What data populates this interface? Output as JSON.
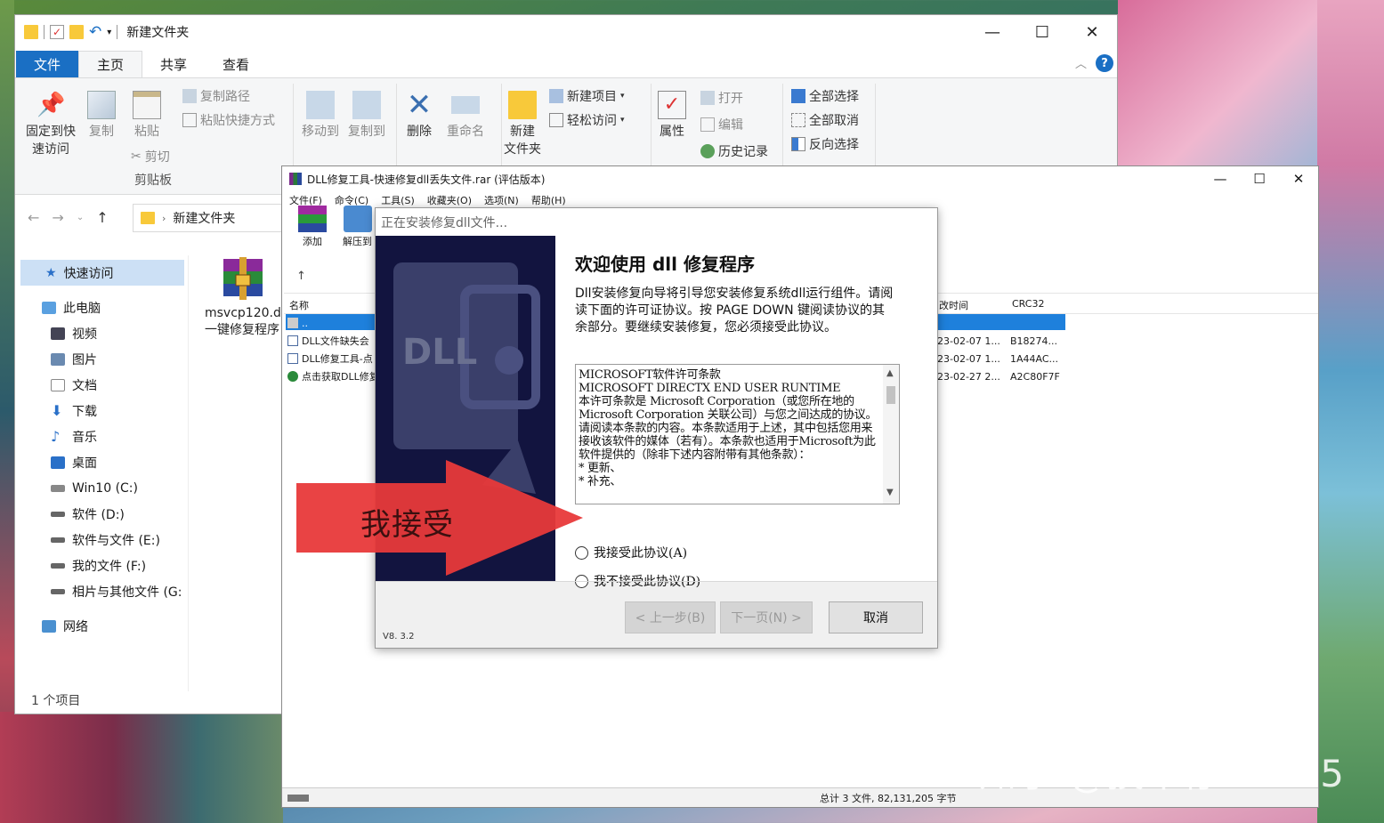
{
  "explorer": {
    "title": "新建文件夹",
    "tabs": [
      "文件",
      "主页",
      "共享",
      "查看"
    ],
    "ribbon": {
      "pin": [
        "固定到快",
        "速访问"
      ],
      "copy": "复制",
      "paste": "粘贴",
      "copy_path": "复制路径",
      "paste_shortcut": "粘贴快捷方式",
      "cut": "剪切",
      "clipboard_group": "剪贴板",
      "move_to": "移动到",
      "copy_to": "复制到",
      "delete": "删除",
      "rename": "重命名",
      "new_folder": [
        "新建",
        "文件夹"
      ],
      "new_item": "新建项目",
      "easy_access": "轻松访问",
      "properties": "属性",
      "open": "打开",
      "edit": "编辑",
      "history": "历史记录",
      "select_all": "全部选择",
      "select_none": "全部取消",
      "invert_select": "反向选择"
    },
    "address": {
      "path": "新建文件夹"
    },
    "nav": [
      {
        "label": "快速访问",
        "icon": "star-icon"
      },
      {
        "label": "此电脑",
        "icon": "computer-icon"
      },
      {
        "label": "视频",
        "icon": "video-icon"
      },
      {
        "label": "图片",
        "icon": "picture-icon"
      },
      {
        "label": "文档",
        "icon": "document-icon"
      },
      {
        "label": "下载",
        "icon": "download-icon"
      },
      {
        "label": "音乐",
        "icon": "music-icon"
      },
      {
        "label": "桌面",
        "icon": "desktop-icon"
      },
      {
        "label": "Win10 (C:)",
        "icon": "drive-icon"
      },
      {
        "label": "软件 (D:)",
        "icon": "drive-icon"
      },
      {
        "label": "软件与文件 (E:)",
        "icon": "drive-icon"
      },
      {
        "label": "我的文件 (F:)",
        "icon": "drive-icon"
      },
      {
        "label": "相片与其他文件 (G:",
        "icon": "drive-icon"
      },
      {
        "label": "网络",
        "icon": "network-icon"
      }
    ],
    "file": {
      "name_line1": "msvcp120.d",
      "name_line2": "一键修复程序"
    },
    "status": "1 个项目"
  },
  "rar": {
    "title": "DLL修复工具-快速修复dll丢失文件.rar (评估版本)",
    "menu": [
      "文件(F)",
      "命令(C)",
      "工具(S)",
      "收藏夹(O)",
      "选项(N)",
      "帮助(H)"
    ],
    "toolbar": [
      "添加",
      "解压到"
    ],
    "columns": {
      "name": "名称",
      "modified": "改时间",
      "crc": "CRC32"
    },
    "rows": [
      {
        "name": "..",
        "modified": "",
        "crc": ""
      },
      {
        "name": "DLL文件缺失会",
        "modified": "23-02-07 1...",
        "crc": "B18274..."
      },
      {
        "name": "DLL修复工具-点",
        "modified": "23-02-07 1...",
        "crc": "1A44AC..."
      },
      {
        "name": "点击获取DLL修复",
        "modified": "23-02-27 2...",
        "crc": "A2C80F7F"
      }
    ],
    "status": "总计 3 文件, 82,131,205 字节"
  },
  "dialog": {
    "title": "正在安装修复dll文件...",
    "side_logo": "DLL",
    "heading": "欢迎使用 dll 修复程序",
    "intro": "Dll安装修复向导将引导您安装修复系统dll运行组件。请阅读下面的许可证协议。按 PAGE DOWN 键阅读协议的其余部分。要继续安装修复，您必须接受此协议。",
    "license": "MICROSOFT软件许可条款\nMICROSOFT DIRECTX END USER RUNTIME\n本许可条款是 Microsoft Corporation（或您所在地的 Microsoft Corporation 关联公司）与您之间达成的协议。请阅读本条款的内容。本条款适用于上述，其中包括您用来接收该软件的媒体（若有）。本条款也适用于Microsoft为此软件提供的（除非下述内容附带有其他条款）：\n* 更新、\n* 补充、",
    "accept": "我接受此协议(A)",
    "decline": "我不接受此协议(D)",
    "back": "< 上一步(B)",
    "next": "下一页(N) >",
    "cancel": "取消",
    "version": "V8. 3.2"
  },
  "overlay": {
    "arrow_label": "我接受",
    "arrow_color": "#e8393a"
  },
  "watermark": "知乎 @技术仔88965"
}
